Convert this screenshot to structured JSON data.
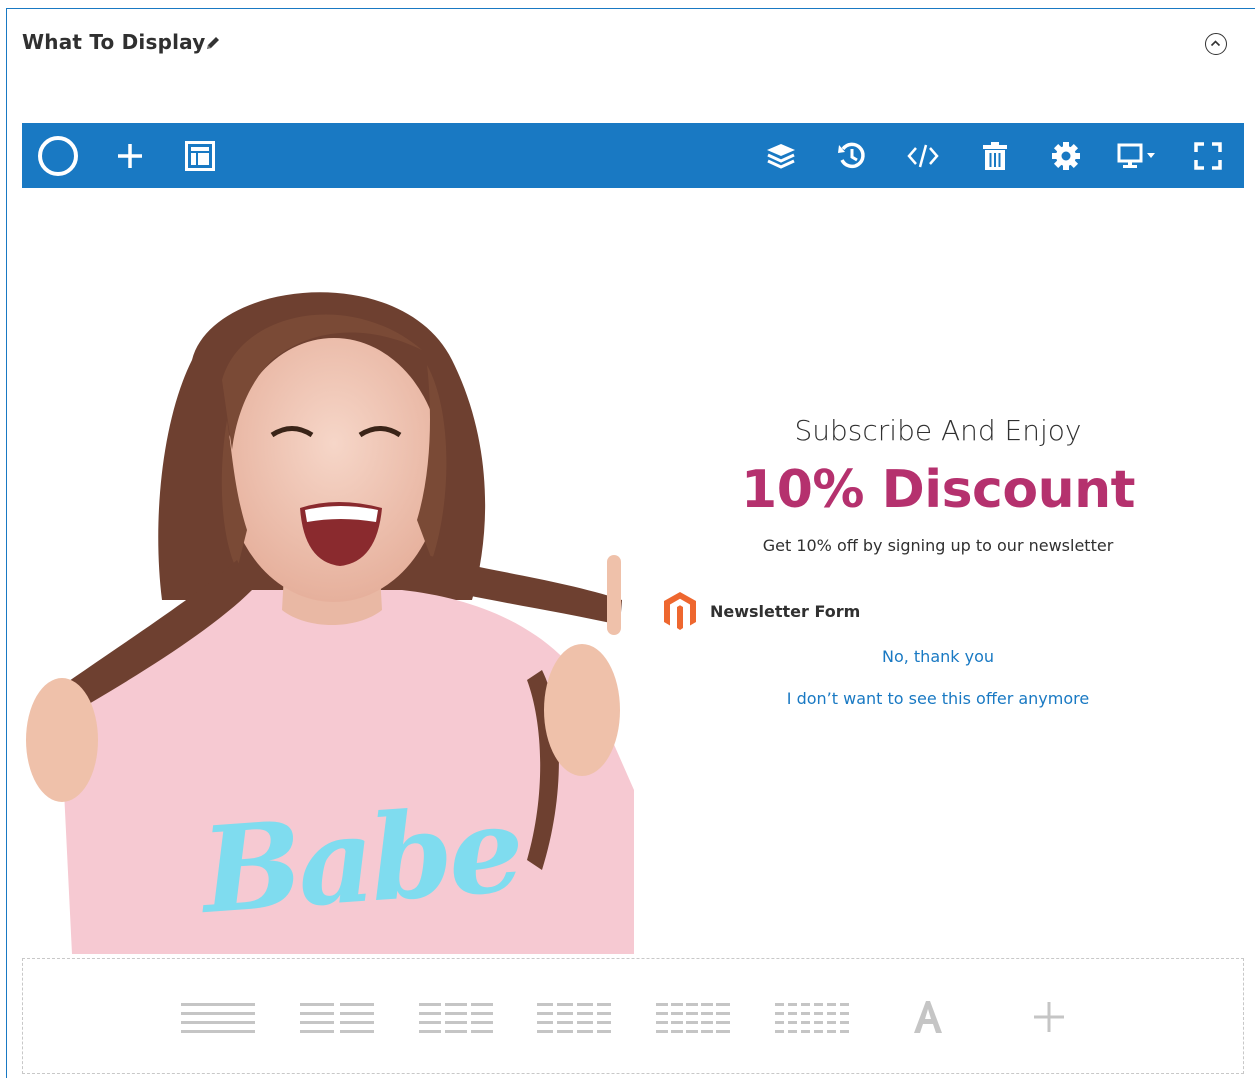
{
  "section": {
    "title": "What To Display"
  },
  "promo": {
    "subtitle": "Subscribe And Enjoy",
    "headline": "10% Discount",
    "description": "Get 10% off by signing up to our newsletter",
    "widget_label": "Newsletter Form",
    "decline_link": "No, thank you",
    "dismiss_link": "I don’t want to see this offer anymore",
    "headline_color": "#b5316e",
    "link_color": "#1979c3"
  },
  "photo": {
    "shirt_text": "Babe",
    "shirt_text_color": "#7fdcef",
    "shirt_color": "#f6c9d2"
  },
  "toolbar": {
    "background": "#1979c3",
    "left_icons": [
      "builder-logo-icon",
      "add-element-icon",
      "templates-icon"
    ],
    "right_icons": [
      "layers-icon",
      "history-icon",
      "code-icon",
      "trash-icon",
      "settings-icon",
      "device-preview-icon",
      "fullscreen-icon"
    ]
  },
  "layout_options": {
    "columns": [
      1,
      2,
      3,
      4,
      5,
      6
    ],
    "extra": [
      "text-element-icon",
      "add-row-icon"
    ]
  }
}
